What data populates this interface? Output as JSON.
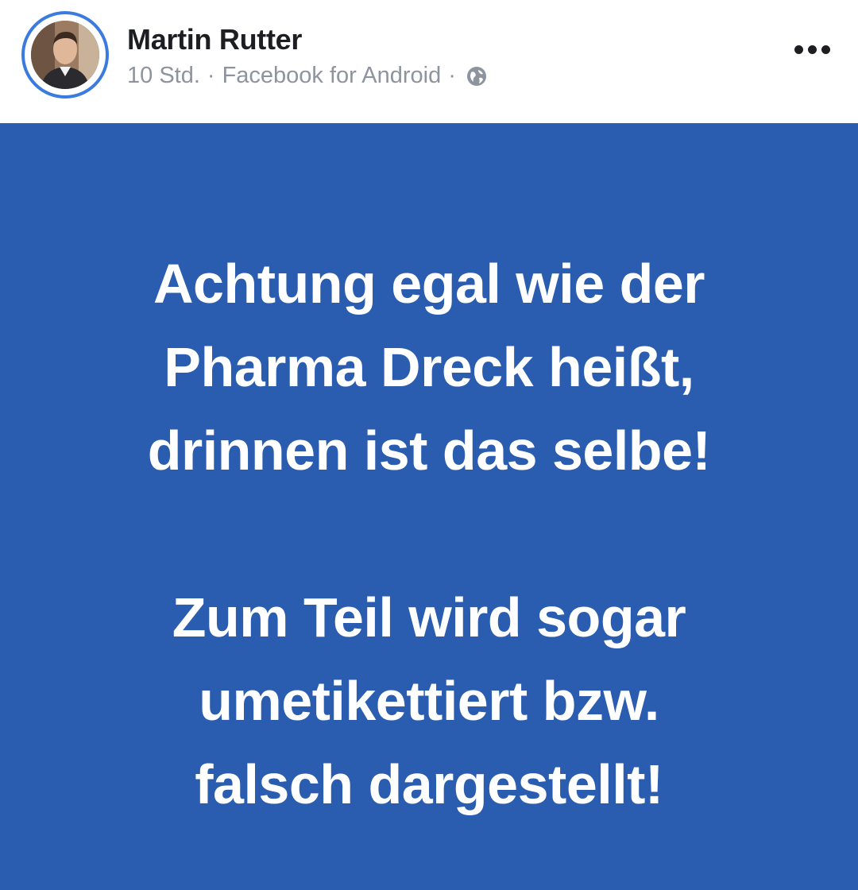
{
  "post": {
    "author": "Martin Rutter",
    "time": "10 Std.",
    "separator": "·",
    "source": "Facebook for Android",
    "audience_icon": "globe-icon",
    "more_icon": "more-dots-icon",
    "background_color": "#2a5db0",
    "text_color": "#ffffff",
    "paragraphs": [
      [
        "Achtung egal wie der",
        "Pharma Dreck heißt,",
        "drinnen ist das selbe!"
      ],
      [
        "Zum Teil wird sogar",
        "umetikettiert bzw.",
        "falsch dargestellt!"
      ]
    ]
  }
}
